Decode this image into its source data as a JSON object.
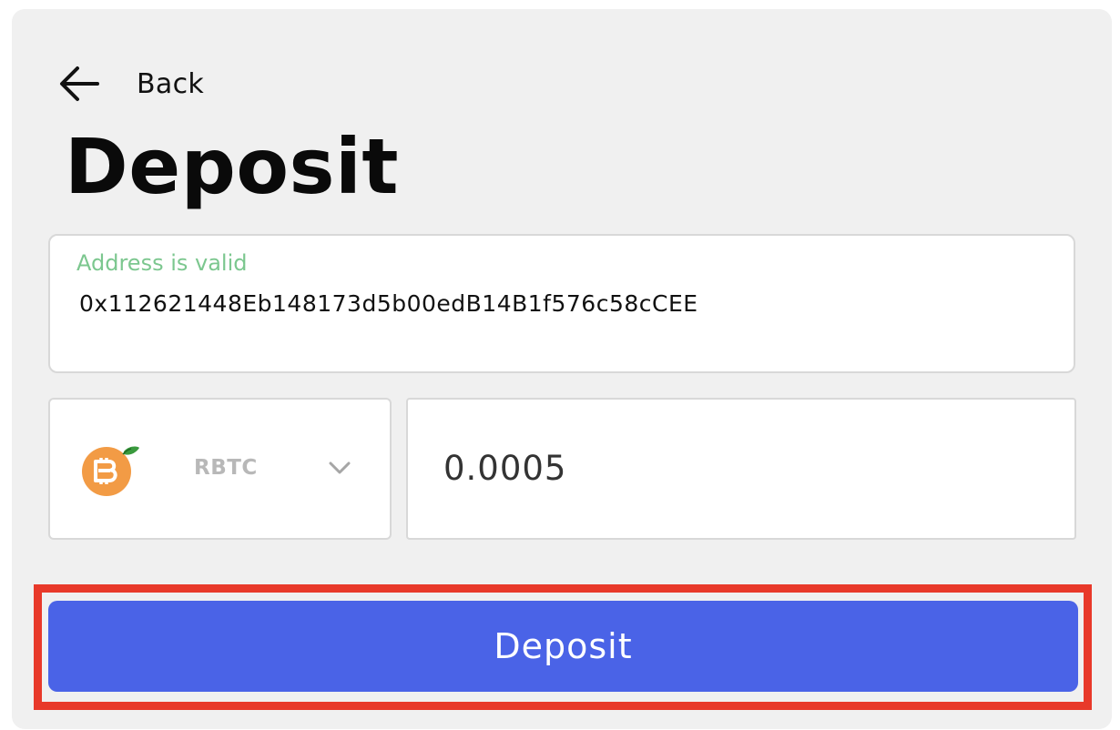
{
  "header": {
    "back_label": "Back",
    "back_icon": "arrow-left-icon",
    "title": "Deposit"
  },
  "address": {
    "status": "Address is valid",
    "value": "0x112621448Eb148173d5b00edB14B1f576c58cCEE"
  },
  "token": {
    "symbol": "RBTC",
    "icon": "rbtc-coin-icon",
    "dropdown_icon": "chevron-down-icon"
  },
  "amount": {
    "value": "0.0005"
  },
  "actions": {
    "deposit_label": "Deposit"
  },
  "colors": {
    "background": "#f0f0f0",
    "valid_status": "#7cc78f",
    "primary_button": "#4a63e7",
    "highlight": "#e8392a",
    "coin_orange": "#f29b45",
    "leaf_green": "#3a9a3e"
  }
}
